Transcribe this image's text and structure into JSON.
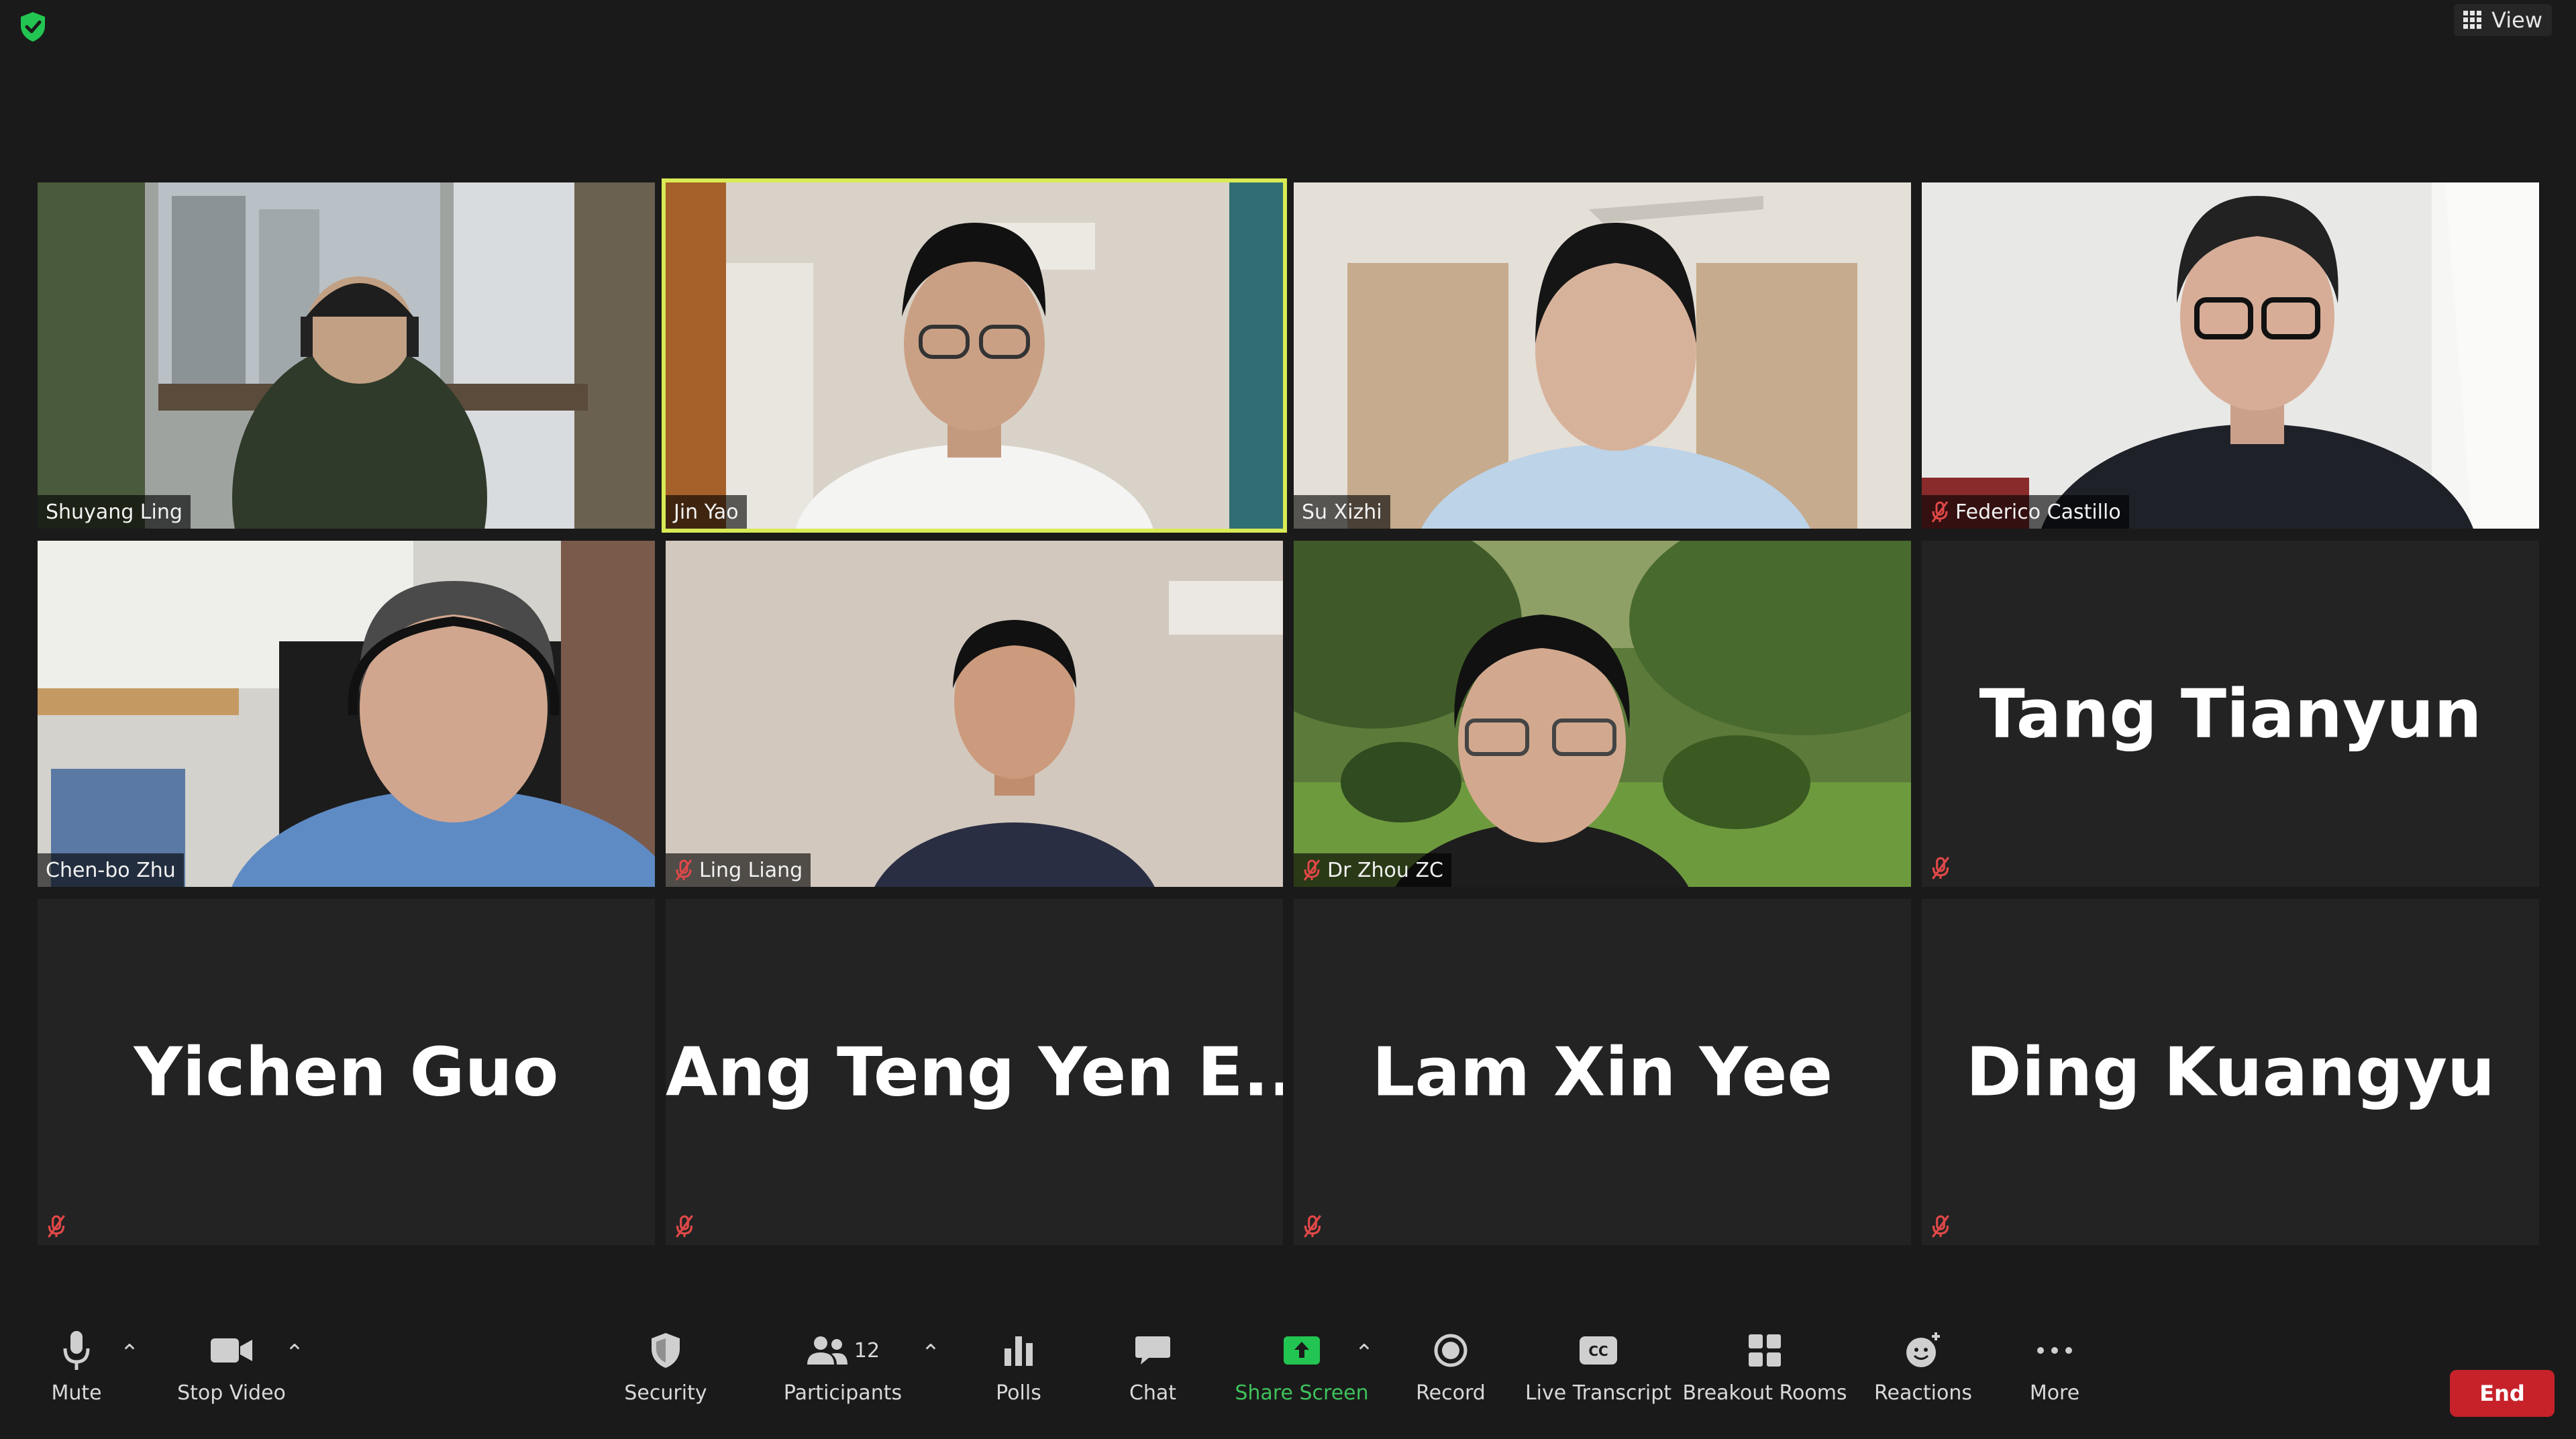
{
  "top_bar": {
    "view_label": "View",
    "security_color": "#23c552"
  },
  "participants": [
    {
      "name": "Shuyang Ling",
      "video": true,
      "muted": false,
      "active": false
    },
    {
      "name": "Jin Yao",
      "video": true,
      "muted": false,
      "active": true
    },
    {
      "name": "Su Xizhi",
      "video": true,
      "muted": false,
      "active": false
    },
    {
      "name": "Federico Castillo",
      "video": true,
      "muted": true,
      "active": false
    },
    {
      "name": "Chen-bo Zhu",
      "video": true,
      "muted": false,
      "active": false
    },
    {
      "name": "Ling Liang",
      "video": true,
      "muted": true,
      "active": false
    },
    {
      "name": "Dr Zhou ZC",
      "video": true,
      "muted": true,
      "active": false
    },
    {
      "name": "Tang Tianyun",
      "video": false,
      "muted": true,
      "active": false
    },
    {
      "name": "Yichen Guo",
      "video": false,
      "muted": true,
      "active": false
    },
    {
      "name": "Ang Teng Yen E...",
      "video": false,
      "muted": true,
      "active": false
    },
    {
      "name": "Lam Xin Yee",
      "video": false,
      "muted": true,
      "active": false
    },
    {
      "name": "Ding Kuangyu",
      "video": false,
      "muted": true,
      "active": false
    }
  ],
  "toolbar": {
    "mute_label": "Mute",
    "stop_video_label": "Stop Video",
    "security_label": "Security",
    "participants_label": "Participants",
    "participants_count": "12",
    "polls_label": "Polls",
    "chat_label": "Chat",
    "share_screen_label": "Share Screen",
    "record_label": "Record",
    "live_transcript_label": "Live Transcript",
    "breakout_rooms_label": "Breakout Rooms",
    "reactions_label": "Reactions",
    "more_label": "More",
    "end_label": "End",
    "share_color": "#23c552",
    "end_color": "#c7222a",
    "active_speaker_color": "#d8ea55"
  }
}
